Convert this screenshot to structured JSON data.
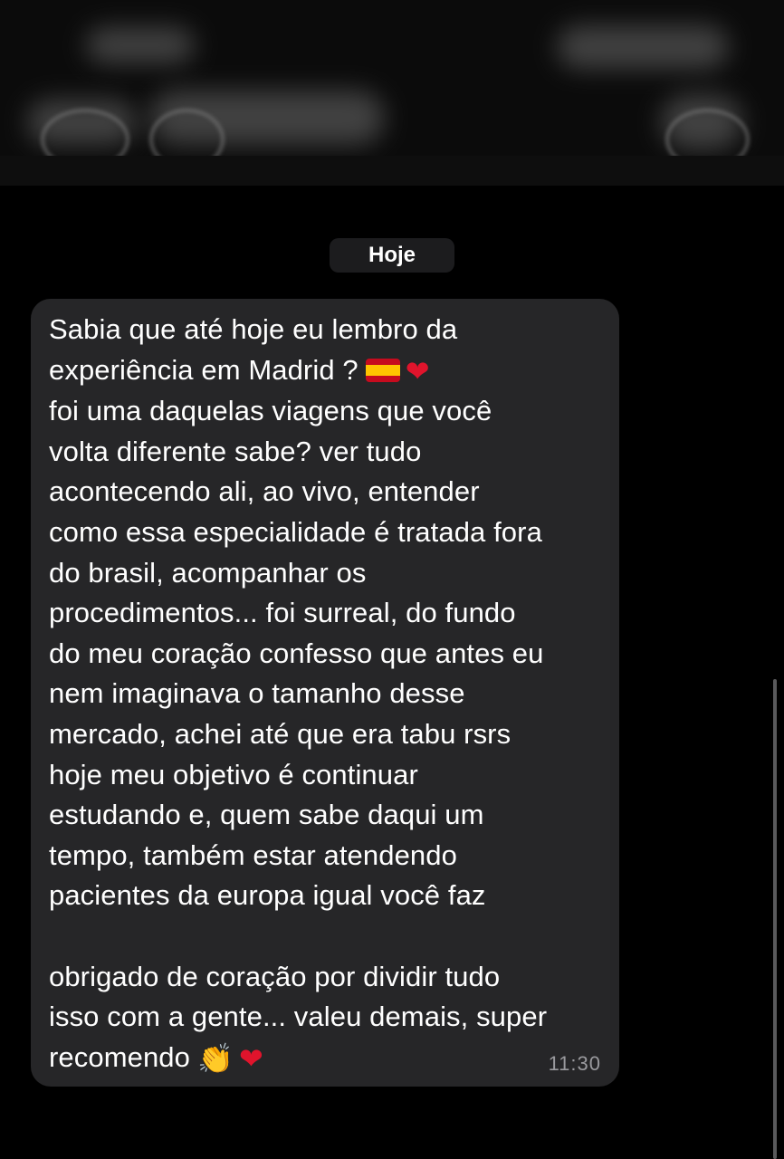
{
  "date_chip": "Hoje",
  "message": {
    "lines": [
      "Sabia que até hoje eu lembro da",
      "experiência em Madrid ?",
      "foi uma daquelas viagens que você",
      "volta diferente sabe? ver tudo",
      "acontecendo ali, ao vivo, entender",
      "como essa especialidade é tratada fora",
      "do brasil, acompanhar os",
      "procedimentos... foi surreal, do fundo",
      "do meu coração confesso que antes eu",
      "nem imaginava o tamanho desse",
      "mercado, achei até que era tabu rsrs",
      "hoje meu objetivo é continuar",
      "estudando e, quem sabe daqui um",
      "tempo, também estar atendendo",
      "pacientes da europa igual você faz",
      "",
      "obrigado de coração por dividir tudo",
      "isso com a gente... valeu demais, super",
      "recomendo"
    ],
    "emojis": {
      "line2": [
        "spain-flag-icon",
        "red-heart-icon"
      ],
      "last_line": [
        "clapping-hands-icon",
        "red-heart-icon"
      ]
    },
    "time": "11:30"
  },
  "colors": {
    "background": "#000000",
    "bubble": "#262628",
    "date_chip": "#1c1c1e",
    "text": "#ffffff",
    "timestamp": "#9a9a9e"
  }
}
